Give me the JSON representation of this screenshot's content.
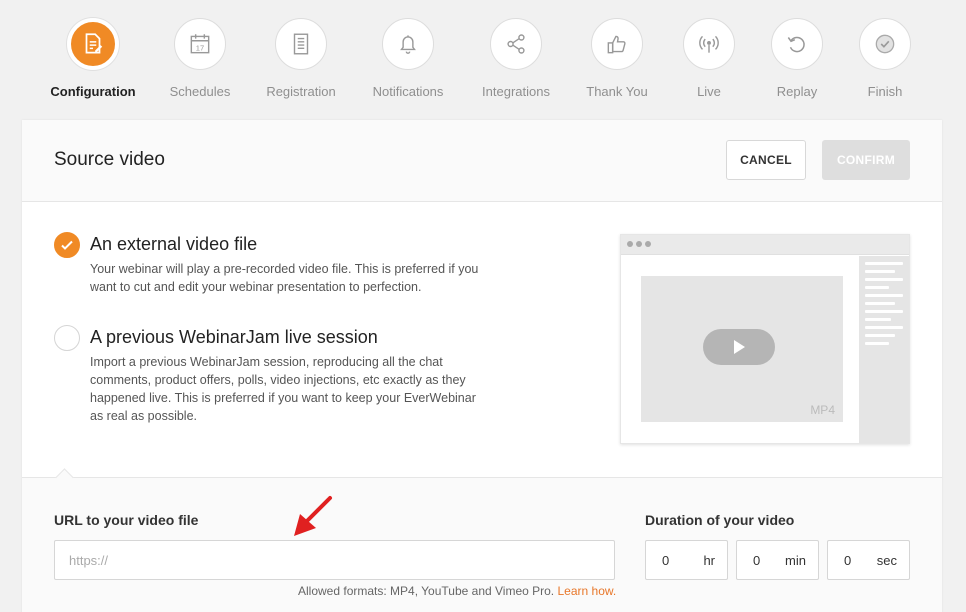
{
  "steps": [
    {
      "label": "Configuration",
      "icon": "edit-document-icon",
      "active": true
    },
    {
      "label": "Schedules",
      "icon": "calendar-icon",
      "active": false
    },
    {
      "label": "Registration",
      "icon": "form-icon",
      "active": false
    },
    {
      "label": "Notifications",
      "icon": "bell-icon",
      "active": false
    },
    {
      "label": "Integrations",
      "icon": "share-icon",
      "active": false
    },
    {
      "label": "Thank You",
      "icon": "thumbs-up-icon",
      "active": false
    },
    {
      "label": "Live",
      "icon": "broadcast-icon",
      "active": false
    },
    {
      "label": "Replay",
      "icon": "replay-icon",
      "active": false
    },
    {
      "label": "Finish",
      "icon": "check-circle-icon",
      "active": false
    }
  ],
  "calendar_day": "17",
  "card": {
    "title": "Source video",
    "cancel_label": "CANCEL",
    "confirm_label": "CONFIRM"
  },
  "options": [
    {
      "title": "An external video file",
      "description": "Your webinar will play a pre-recorded video file. This is preferred if you want to cut and edit your webinar presentation to perfection.",
      "checked": true
    },
    {
      "title": "A previous WebinarJam live session",
      "description": "Import a previous WebinarJam session, reproducing all the chat comments, product offers, polls, video injections, etc exactly as they happened live. This is preferred if you want to keep your EverWebinar as real as possible.",
      "checked": false
    }
  ],
  "preview": {
    "format_tag": "MP4"
  },
  "url_field": {
    "label": "URL to your video file",
    "placeholder": "https://",
    "value": "",
    "hint": "Allowed formats: MP4, YouTube and Vimeo Pro.",
    "learn_link": "Learn how."
  },
  "duration": {
    "label": "Duration of your video",
    "hours": {
      "value": "0",
      "unit": "hr"
    },
    "minutes": {
      "value": "0",
      "unit": "min"
    },
    "seconds": {
      "value": "0",
      "unit": "sec"
    }
  },
  "colors": {
    "accent": "#f08a25",
    "link": "#e8772a",
    "annotation_arrow": "#e02020"
  }
}
